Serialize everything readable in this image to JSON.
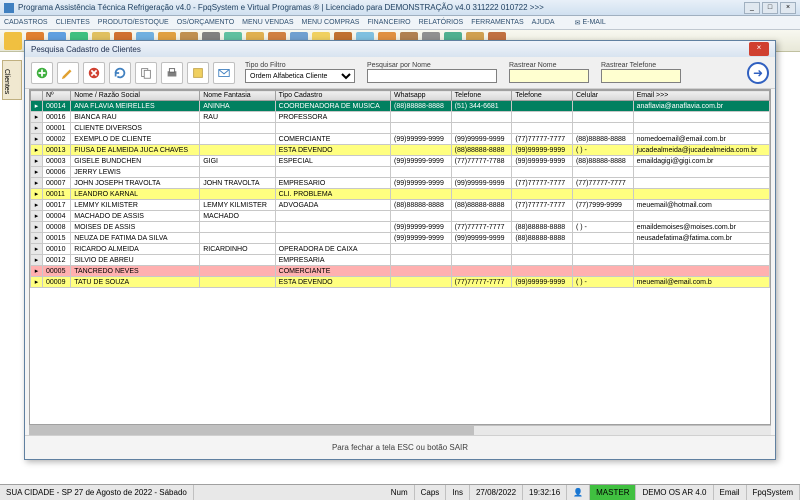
{
  "window": {
    "title": "Programa Assistência Técnica Refrigeração v4.0 - FpqSystem e Virtual Programas ® | Licenciado para  DEMONSTRAÇÃO v4.0 311222 010722 >>>"
  },
  "menu": [
    "CADASTROS",
    "CLIENTES",
    "PRODUTO/ESTOQUE",
    "OS/ORÇAMENTO",
    "MENU VENDAS",
    "MENU COMPRAS",
    "FINANCEIRO",
    "RELATÓRIOS",
    "FERRAMENTAS",
    "AJUDA"
  ],
  "email_label": "E-MAIL",
  "sidebar_tab": "Clientes",
  "dialog": {
    "title": "Pesquisa Cadastro de Clientes",
    "filter_label": "Tipo do Filtro",
    "filter_value": "Ordem Alfabetica Cliente",
    "search_label": "Pesquisar por Nome",
    "track_name_label": "Rastrear Nome",
    "track_phone_label": "Rastrear Telefone",
    "footer": "Para fechar a tela ESC ou botão SAIR"
  },
  "columns": [
    "",
    "Nº",
    "Nome / Razão Social",
    "Nome Fantasia",
    "Tipo Cadastro",
    "Whatsapp",
    "Telefone",
    "Telefone",
    "Celular",
    "Email >>>"
  ],
  "rows": [
    {
      "cls": "sel",
      "n": "00014",
      "nome": "ANA FLAVIA MEIRELLES",
      "fant": "ANINHA",
      "tipo": "COORDENADORA DE MUSICA",
      "wa": "(88)88888-8888",
      "t1": "(51) 344-6681",
      "t2": "",
      "cel": "",
      "em": "anaflavia@anaflavia.com.br"
    },
    {
      "cls": "",
      "n": "00016",
      "nome": "BIANCA RAU",
      "fant": "RAU",
      "tipo": "PROFESSORA",
      "wa": "",
      "t1": "",
      "t2": "",
      "cel": "",
      "em": ""
    },
    {
      "cls": "",
      "n": "00001",
      "nome": "CLIENTE DIVERSOS",
      "fant": "",
      "tipo": "",
      "wa": "",
      "t1": "",
      "t2": "",
      "cel": "",
      "em": ""
    },
    {
      "cls": "",
      "n": "00002",
      "nome": "EXEMPLO DE CLIENTE",
      "fant": "",
      "tipo": "COMERCIANTE",
      "wa": "(99)99999-9999",
      "t1": "(99)99999-9999",
      "t2": "(77)77777-7777",
      "cel": "(88)88888-8888",
      "em": "nomedoemail@email.com.br"
    },
    {
      "cls": "yellow",
      "n": "00013",
      "nome": "FIUSA DE ALMEIDA JUCA CHAVES",
      "fant": "",
      "tipo": "ESTA DEVENDO",
      "wa": "",
      "t1": "(88)88888-8888",
      "t2": "(99)99999-9999",
      "cel": "( )    -",
      "em": "jucadealmeida@jucadealmeida.com.br"
    },
    {
      "cls": "",
      "n": "00003",
      "nome": "GISELE BUNDCHEN",
      "fant": "GIGI",
      "tipo": "ESPECIAL",
      "wa": "(99)99999-9999",
      "t1": "(77)77777-7788",
      "t2": "(99)99999-9999",
      "cel": "(88)88888-8888",
      "em": "emaildagigi@gigi.com.br"
    },
    {
      "cls": "",
      "n": "00006",
      "nome": "JERRY LEWIS",
      "fant": "",
      "tipo": "",
      "wa": "",
      "t1": "",
      "t2": "",
      "cel": "",
      "em": ""
    },
    {
      "cls": "",
      "n": "00007",
      "nome": "JOHN JOSEPH TRAVOLTA",
      "fant": "JOHN TRAVOLTA",
      "tipo": "EMPRESARIO",
      "wa": "(99)99999-9999",
      "t1": "(99)99999-9999",
      "t2": "(77)77777-7777",
      "cel": "(77)77777-7777",
      "em": ""
    },
    {
      "cls": "yellow",
      "n": "00011",
      "nome": "LEANDRO KARNAL",
      "fant": "",
      "tipo": "CLI. PROBLEMA",
      "wa": "",
      "t1": "",
      "t2": "",
      "cel": "",
      "em": ""
    },
    {
      "cls": "",
      "n": "00017",
      "nome": "LEMMY KILMISTER",
      "fant": "LEMMY KILMISTER",
      "tipo": "ADVOGADA",
      "wa": "(88)88888-8888",
      "t1": "(88)88888-8888",
      "t2": "(77)77777-7777",
      "cel": "(77)7999-9999",
      "em": "meuemail@hotmail.com"
    },
    {
      "cls": "",
      "n": "00004",
      "nome": "MACHADO DE ASSIS",
      "fant": "MACHADO",
      "tipo": "",
      "wa": "",
      "t1": "",
      "t2": "",
      "cel": "",
      "em": ""
    },
    {
      "cls": "",
      "n": "00008",
      "nome": "MOISES DE ASSIS",
      "fant": "",
      "tipo": "",
      "wa": "(99)99999-9999",
      "t1": "(77)77777-7777",
      "t2": "(88)88888-8888",
      "cel": "( )    -",
      "em": "emaildemoises@moises.com.br"
    },
    {
      "cls": "",
      "n": "00015",
      "nome": "NEUZA DE FATIMA DA SILVA",
      "fant": "",
      "tipo": "",
      "wa": "(99)99999-9999",
      "t1": "(99)99999-9999",
      "t2": "(88)88888-8888",
      "cel": "",
      "em": "neusadefatima@fatima.com.br"
    },
    {
      "cls": "",
      "n": "00010",
      "nome": "RICARDO ALMEIDA",
      "fant": "RICARDINHO",
      "tipo": "OPERADORA DE CAIXA",
      "wa": "",
      "t1": "",
      "t2": "",
      "cel": "",
      "em": ""
    },
    {
      "cls": "",
      "n": "00012",
      "nome": "SILVIO DE ABREU",
      "fant": "",
      "tipo": "EMPRESARIA",
      "wa": "",
      "t1": "",
      "t2": "",
      "cel": "",
      "em": ""
    },
    {
      "cls": "pink",
      "n": "00005",
      "nome": "TANCREDO NEVES",
      "fant": "",
      "tipo": "COMERCIANTE",
      "wa": "",
      "t1": "",
      "t2": "",
      "cel": "",
      "em": ""
    },
    {
      "cls": "yellow",
      "n": "00009",
      "nome": "TATU DE SOUZA",
      "fant": "",
      "tipo": "ESTA DEVENDO",
      "wa": "",
      "t1": "(77)77777-7777",
      "t2": "(99)99999-9999",
      "cel": "( )    -",
      "em": "meuemail@email.com.b"
    }
  ],
  "status": {
    "left": "SUA CIDADE - SP 27 de Agosto de 2022 - Sábado",
    "num": "Num",
    "caps": "Caps",
    "ins": "Ins",
    "date": "27/08/2022",
    "time": "19:32:16",
    "master": "MASTER",
    "demo": "DEMO OS AR 4.0",
    "email": "Email",
    "brand": "FpqSystem"
  },
  "toolbar_colors": [
    "#f0c040",
    "#e08030",
    "#60a0e0",
    "#40c080",
    "#e0c060",
    "#d07030",
    "#70b0e0",
    "#e0a040",
    "#c09050",
    "#808080",
    "#60c0a0",
    "#e0b050",
    "#d08040",
    "#70a0d0",
    "#f0d060",
    "#c07030",
    "#80c0e0",
    "#e09040",
    "#b08050",
    "#909090",
    "#50b090",
    "#d0a050",
    "#c07040"
  ]
}
